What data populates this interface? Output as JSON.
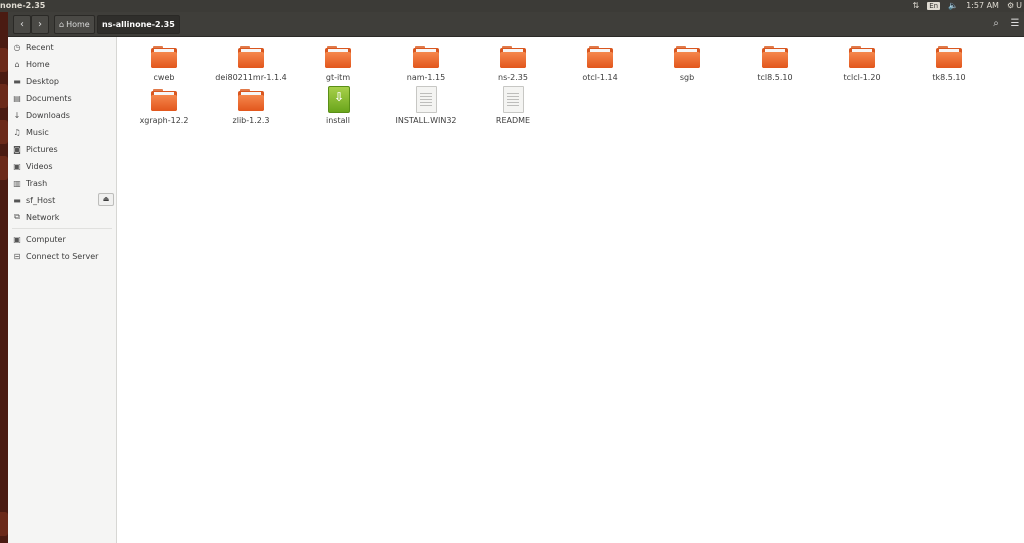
{
  "top_panel": {
    "window_title": "none-2.35",
    "keyboard": "En",
    "clock": "1:57 AM",
    "user_initial": "U"
  },
  "header": {
    "breadcrumbs": [
      {
        "label": "Home",
        "icon": "home-icon"
      },
      {
        "label": "ns-allinone-2.35"
      }
    ]
  },
  "sidebar": {
    "items": [
      {
        "label": "Recent",
        "icon": "clock-icon"
      },
      {
        "label": "Home",
        "icon": "home-icon"
      },
      {
        "label": "Desktop",
        "icon": "desktop-icon"
      },
      {
        "label": "Documents",
        "icon": "documents-icon"
      },
      {
        "label": "Downloads",
        "icon": "download-icon"
      },
      {
        "label": "Music",
        "icon": "music-icon"
      },
      {
        "label": "Pictures",
        "icon": "camera-icon"
      },
      {
        "label": "Videos",
        "icon": "film-icon"
      },
      {
        "label": "Trash",
        "icon": "trash-icon"
      },
      {
        "label": "sf_Host",
        "icon": "drive-icon"
      },
      {
        "label": "Network",
        "icon": "network-icon"
      },
      {
        "label": "Computer",
        "icon": "computer-icon"
      },
      {
        "label": "Connect to Server",
        "icon": "server-icon"
      }
    ]
  },
  "files": [
    {
      "name": "cweb",
      "type": "folder"
    },
    {
      "name": "dei80211mr-1.1.4",
      "type": "folder"
    },
    {
      "name": "gt-itm",
      "type": "folder"
    },
    {
      "name": "nam-1.15",
      "type": "folder"
    },
    {
      "name": "ns-2.35",
      "type": "folder"
    },
    {
      "name": "otcl-1.14",
      "type": "folder"
    },
    {
      "name": "sgb",
      "type": "folder"
    },
    {
      "name": "tcl8.5.10",
      "type": "folder"
    },
    {
      "name": "tclcl-1.20",
      "type": "folder"
    },
    {
      "name": "tk8.5.10",
      "type": "folder"
    },
    {
      "name": "xgraph-12.2",
      "type": "folder"
    },
    {
      "name": "zlib-1.2.3",
      "type": "folder"
    },
    {
      "name": "install",
      "type": "executable"
    },
    {
      "name": "INSTALL.WIN32",
      "type": "text"
    },
    {
      "name": "README",
      "type": "text"
    }
  ],
  "colors": {
    "folder": "#e2561c",
    "header_bg": "#3f3e3a",
    "panel_bg": "#3c3b37",
    "sidebar_bg": "#f5f5f4"
  }
}
